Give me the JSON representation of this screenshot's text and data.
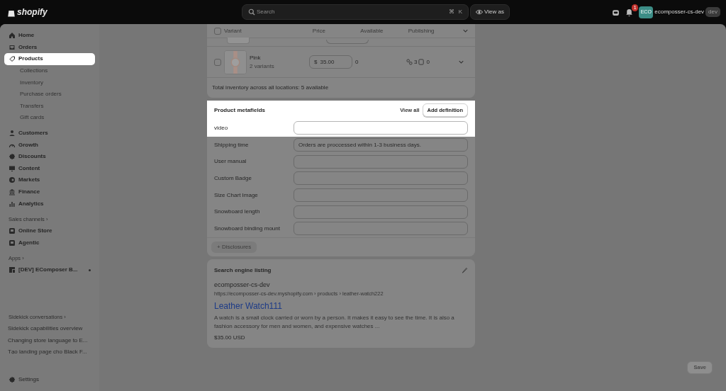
{
  "topbar": {
    "logo": "shopify",
    "search": {
      "placeholder": "Search"
    },
    "shortcut": [
      "⌘",
      "K"
    ],
    "view_as": "View as",
    "notification_count": "1",
    "avatar": "ECO",
    "store": "ecomposser-cs-dev",
    "store_badge": "dev"
  },
  "sidebar": {
    "items": [
      {
        "label": "Home",
        "selected": false
      },
      {
        "label": "Orders",
        "selected": false
      },
      {
        "label": "Products",
        "selected": true,
        "children": [
          {
            "label": "Collections"
          },
          {
            "label": "Inventory"
          },
          {
            "label": "Purchase orders"
          },
          {
            "label": "Transfers"
          },
          {
            "label": "Gift cards"
          }
        ]
      },
      {
        "label": "Customers",
        "selected": false
      },
      {
        "label": "Growth",
        "selected": false
      },
      {
        "label": "Discounts",
        "selected": false
      },
      {
        "label": "Content",
        "selected": false
      },
      {
        "label": "Markets",
        "selected": false
      },
      {
        "label": "Finance",
        "selected": false
      },
      {
        "label": "Analytics",
        "selected": false
      }
    ],
    "sales_channels": {
      "title": "Sales channels ›",
      "items": [
        {
          "label": "Online Store"
        },
        {
          "label": "Agentic"
        }
      ]
    },
    "apps": {
      "title": "Apps ›",
      "items": [
        {
          "label": "[DEV] EComposer B..."
        }
      ]
    },
    "sidekick": {
      "title": "Sidekick conversations ›",
      "items": [
        {
          "label": "Sidekick capabilities overview"
        },
        {
          "label": "Changing store language to E..."
        },
        {
          "label": "Tạo landing page cho Black F..."
        }
      ]
    },
    "settings": "Settings"
  },
  "variants": {
    "select_all_checked": false,
    "columns": [
      "Variant",
      "Price",
      "Available",
      "Publishing"
    ],
    "rows": [
      {
        "kind": "partial"
      },
      {
        "kind": "full",
        "checked": false,
        "name": "Pink",
        "subtitle": "2 variants",
        "currency": "$",
        "price": "35.00",
        "available": "0",
        "markets": "3",
        "catalogs": "0"
      }
    ],
    "total": "Total inventory across all locations: 5 available"
  },
  "metafields": {
    "title": "Product metafields",
    "highlighted": true,
    "view_all": "View all",
    "add_definition": "Add definition",
    "fields": [
      {
        "label": "video",
        "highlighted": true
      },
      {
        "label": "Shipping time",
        "value": "Orders are proccessed within 1-3 business days.",
        "highlighted": false
      },
      {
        "label": "User manual",
        "highlighted": false
      },
      {
        "label": "Custom Badge",
        "highlighted": false
      },
      {
        "label": "Size Chart Image",
        "highlighted": false
      },
      {
        "label": "Snowboard length",
        "highlighted": false
      },
      {
        "label": "Snowboard binding mount",
        "highlighted": false
      }
    ],
    "disclosures": "+ Disclosures"
  },
  "seo": {
    "title": "Search engine listing",
    "store": "ecomposser-cs-dev",
    "url": "https://ecomposser-cs-dev.myshopify.com › products › leather-watch222",
    "page_title": "Leather Watch111",
    "description": "A watch is a small clock carried or worn by a person. It makes it easy to see the time. It is also a fashion accessory for men and women, and expensive watches ...",
    "price": "$35.00 USD"
  },
  "save": {
    "label": "Save",
    "disabled": true
  }
}
